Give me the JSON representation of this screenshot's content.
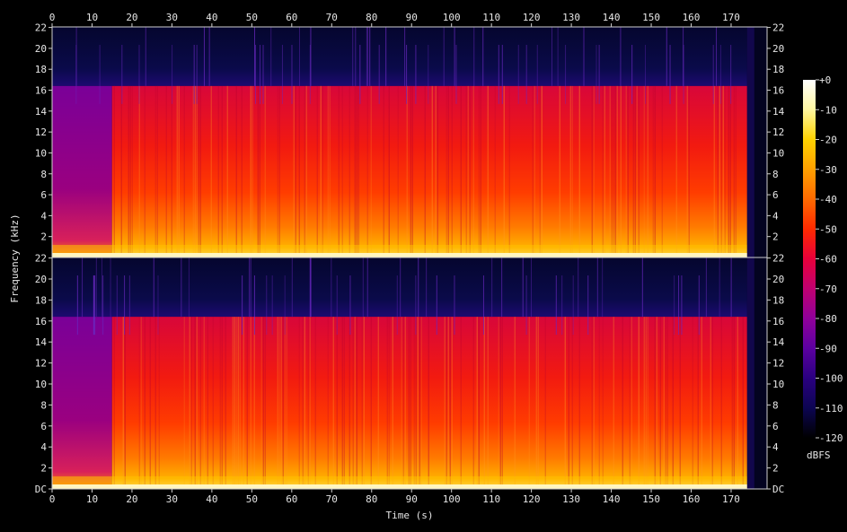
{
  "chart_data": {
    "type": "heatmap",
    "xlabel": "Time (s)",
    "ylabel": "Frequency (kHz)",
    "xlim": [
      0,
      179
    ],
    "ylim": [
      0,
      22.05
    ],
    "x_ticks": [
      0,
      10,
      20,
      30,
      40,
      50,
      60,
      70,
      80,
      90,
      100,
      110,
      120,
      130,
      140,
      150,
      160,
      170
    ],
    "x_tick_labels": [
      "0",
      "10",
      "20",
      "30",
      "40",
      "50",
      "60",
      "70",
      "80",
      "90",
      "100",
      "110",
      "120",
      "130",
      "140",
      "150",
      "160",
      "170"
    ],
    "y_ticks": [
      0,
      2,
      4,
      6,
      8,
      10,
      12,
      14,
      16,
      18,
      20,
      22
    ],
    "y_tick_labels_upper": [
      "",
      "2",
      "4",
      "6",
      "8",
      "10",
      "12",
      "14",
      "16",
      "18",
      "20",
      "22"
    ],
    "y_tick_labels_lower": [
      "DC",
      "2",
      "4",
      "6",
      "8",
      "10",
      "12",
      "14",
      "16",
      "18",
      "20",
      "22"
    ],
    "channels": 2,
    "audio_end_s": 174,
    "lowpass_cutoff_khz": 16.4,
    "intro_end_s": 15,
    "colorbar": {
      "label": "dBFS",
      "ticks": [
        0,
        -10,
        -20,
        -30,
        -40,
        -50,
        -60,
        -70,
        -80,
        -90,
        -100,
        -110,
        -120
      ],
      "tick_labels": [
        "+0",
        "-10",
        "-20",
        "-30",
        "-40",
        "-50",
        "-60",
        "-70",
        "-80",
        "-90",
        "-100",
        "-110",
        "-120"
      ],
      "stops": [
        {
          "db": 0,
          "color": "#ffffff"
        },
        {
          "db": -10,
          "color": "#fff7a0"
        },
        {
          "db": -20,
          "color": "#ffd200"
        },
        {
          "db": -30,
          "color": "#ffa000"
        },
        {
          "db": -40,
          "color": "#ff6a00"
        },
        {
          "db": -50,
          "color": "#ff2a00"
        },
        {
          "db": -60,
          "color": "#e8003a"
        },
        {
          "db": -70,
          "color": "#c00070"
        },
        {
          "db": -80,
          "color": "#90009a"
        },
        {
          "db": -90,
          "color": "#5c00a0"
        },
        {
          "db": -100,
          "color": "#2a0080"
        },
        {
          "db": -110,
          "color": "#0c0552"
        },
        {
          "db": -120,
          "color": "#000000"
        }
      ]
    }
  }
}
